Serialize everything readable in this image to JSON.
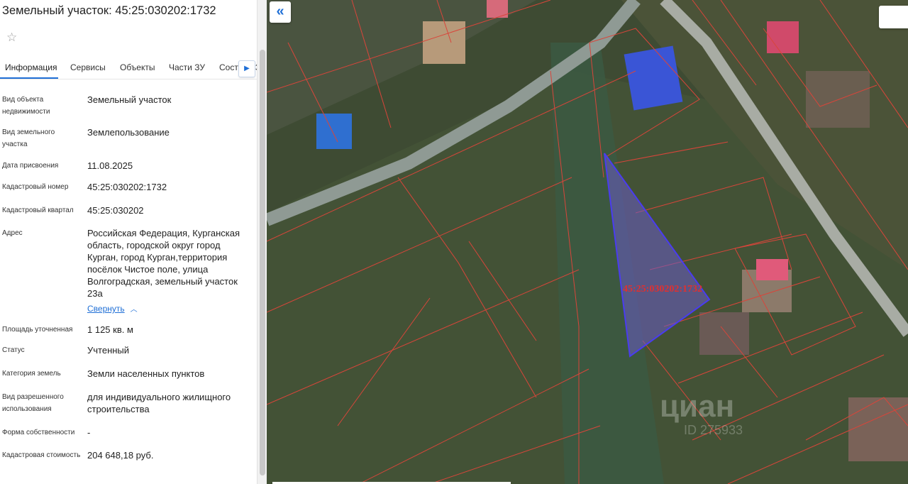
{
  "panel": {
    "title": "Земельный участок: 45:25:030202:1732",
    "favorite_icon": "star-icon",
    "tabs": [
      {
        "label": "Информация"
      },
      {
        "label": "Сервисы"
      },
      {
        "label": "Объекты"
      },
      {
        "label": "Части ЗУ"
      },
      {
        "label": "Состав ЕЗП"
      }
    ],
    "tabs_next_icon": "chevron-right-icon",
    "fields": [
      {
        "label": "Вид объекта недвижимости",
        "value": "Земельный участок"
      },
      {
        "label": "Вид земельного участка",
        "value": "Землепользование"
      },
      {
        "label": "Дата присвоения",
        "value": "11.08.2025"
      },
      {
        "label": "Кадастровый номер",
        "value": "45:25:030202:1732"
      },
      {
        "label": "Кадастровый квартал",
        "value": "45:25:030202"
      },
      {
        "label": "Адрес",
        "value": "Российская Федерация, Курганская область, городской округ город Курган, город Курган,территория посёлок Чистое поле, улица Волгоградская, земельный участок 23а"
      },
      {
        "label": "Площадь уточненная",
        "value": "1 125 кв. м"
      },
      {
        "label": "Статус",
        "value": "Учтенный"
      },
      {
        "label": "Категория земель",
        "value": "Земли населенных пунктов"
      },
      {
        "label": "Вид разрешенного использования",
        "value": "для индивидуального жилищного строительства"
      },
      {
        "label": "Форма собственности",
        "value": "-"
      },
      {
        "label": "Кадастровая стоимость",
        "value": "204 648,18 руб."
      }
    ],
    "collapse_link": "Свернуть",
    "collapse_icon": "chevron-up-icon"
  },
  "map": {
    "collapse_panel_icon": "double-chevron-left-icon",
    "parcel_label": "45:25:030202:1732",
    "watermark": "циан",
    "watermark_id": "ID 275933",
    "parcel_fill": "#6a5bc7",
    "parcel_stroke": "#4a3cf0",
    "boundary_color": "#d9453a",
    "accent": "#1f6fd6"
  }
}
